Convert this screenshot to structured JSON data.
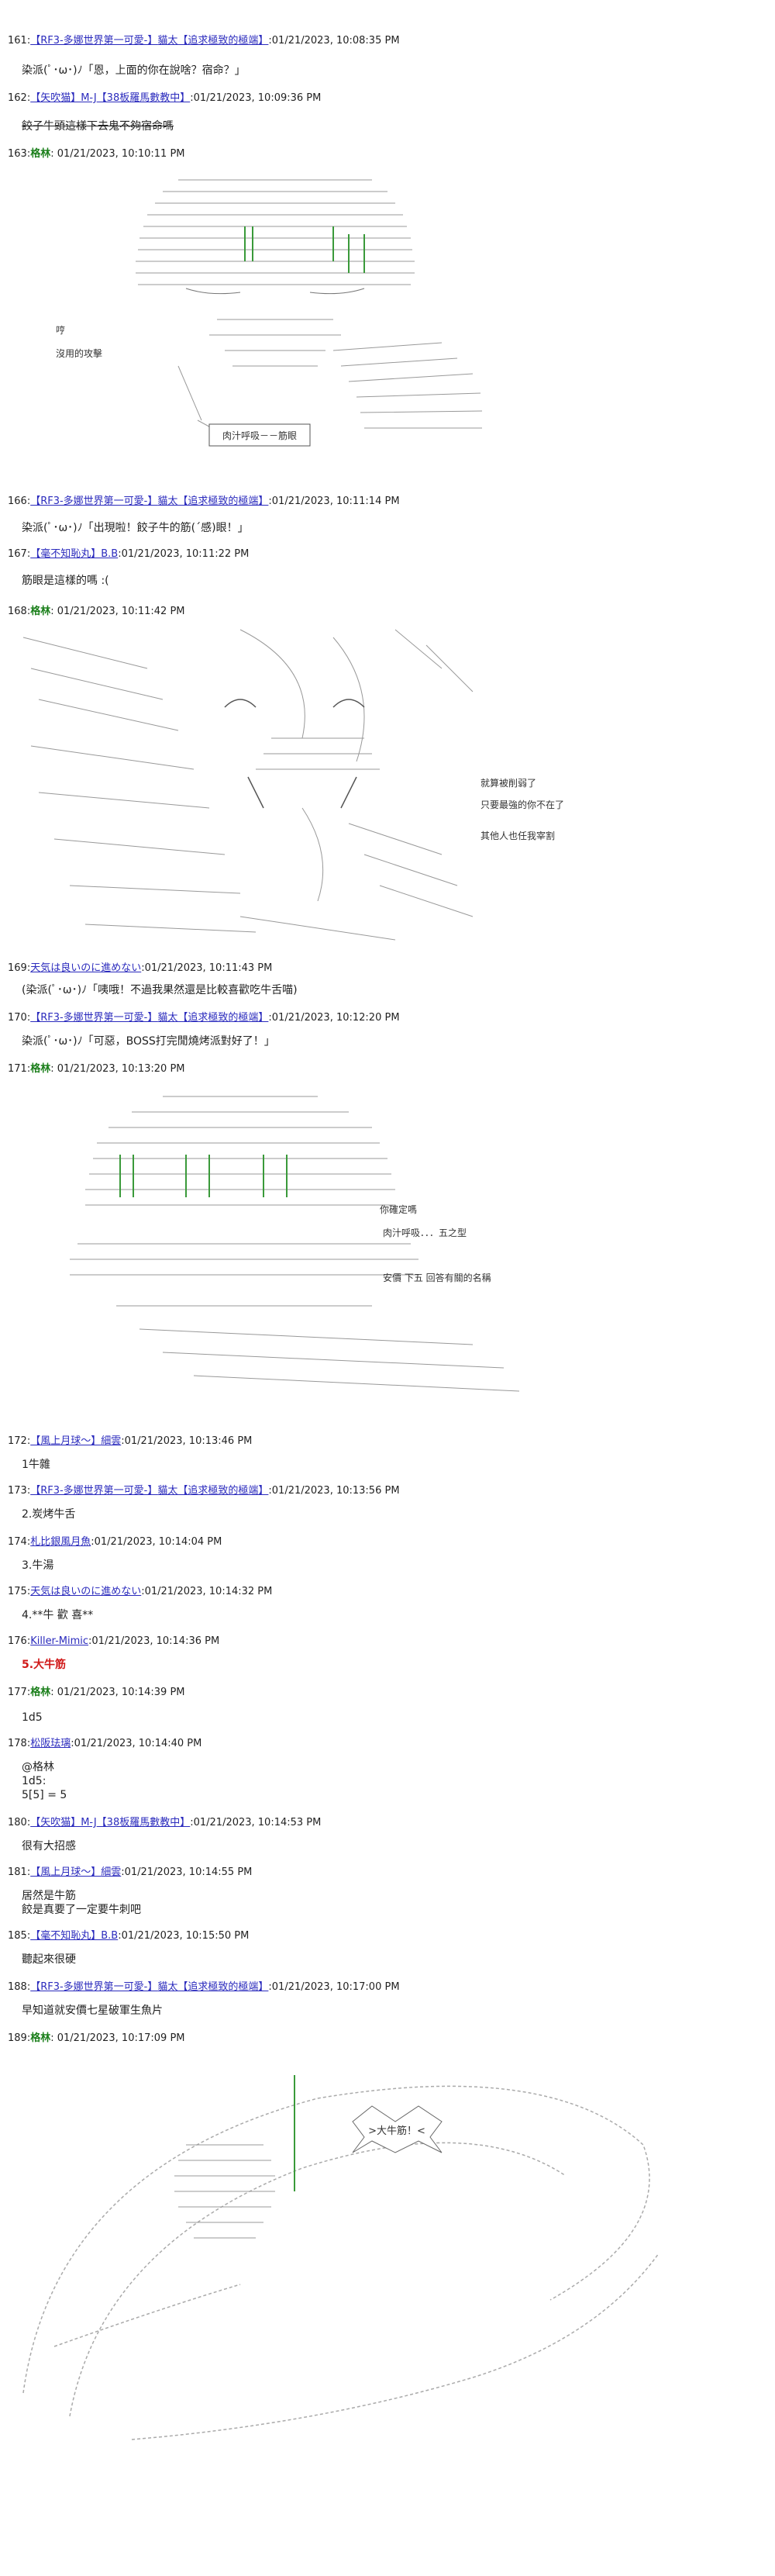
{
  "posts": [
    {
      "num": "161:",
      "user": "【RF3-多娜世界第一可愛-】",
      "tag": "貓太【追求極致的極端】",
      "date": ":01/21/2023, 10:08:35 PM",
      "body": "染派(ﾟ･ω･)ﾉ「恩，上面的你在說啥？宿命？」"
    },
    {
      "num": "162:",
      "user": "【矢吹猫】M-J",
      "tag": "【38板羅馬數教中】",
      "date": ":01/21/2023, 10:09:36 PM",
      "body": "餃子牛頭這樣下去鬼不夠宿命嗎"
    },
    {
      "num": "163:",
      "user": "格林",
      "date": ": 01/21/2023, 10:10:11 PM",
      "aa_text": [
        "哼",
        "沒用的攻擊"
      ],
      "bubble": "肉汁呼吸－－筋眼"
    },
    {
      "num": "166:",
      "user": "【RF3-多娜世界第一可愛-】",
      "tag": "貓太【追求極致的極端】",
      "date": ":01/21/2023, 10:11:14 PM",
      "body": "染派(ﾟ･ω･)ﾉ「出現啦！餃子牛的筋(ˊ感)眼！」"
    },
    {
      "num": "167:",
      "user": "【毫不知恥丸】B.B",
      "date": ":01/21/2023, 10:11:22 PM",
      "body": "筋眼是這樣的嗎 :("
    },
    {
      "num": "168:",
      "user": "格林",
      "date": ": 01/21/2023, 10:11:42 PM",
      "aa_text": [
        "就算被削弱了",
        "只要最強的你不在了",
        "其他人也任我宰割"
      ]
    },
    {
      "num": "169:",
      "user": "天気は良いのに進めない",
      "date": ":01/21/2023, 10:11:43 PM",
      "body": "(染派(ﾟ･ω･)ﾉ「咦哦！不過我果然還是比較喜歡吃牛舌喵)"
    },
    {
      "num": "170:",
      "user": "【RF3-多娜世界第一可愛-】",
      "tag": "貓太【追求極致的極端】",
      "date": ":01/21/2023, 10:12:20 PM",
      "body": "染派(ﾟ･ω･)ﾉ「可惡，BOSS打完閒燒烤派對好了！」"
    },
    {
      "num": "171:",
      "user": "格林",
      "date": ": 01/21/2023, 10:13:20 PM",
      "aa_text": [
        "你確定嗎",
        "肉汁呼吸．．．五之型",
        "安價 下五 回答有關的名稱"
      ]
    },
    {
      "num": "172:",
      "user": "【風上月球～】",
      "tag": "細雲",
      "date": ":01/21/2023, 10:13:46 PM",
      "body": "1牛雜"
    },
    {
      "num": "173:",
      "user": "【RF3-多娜世界第一可愛-】",
      "tag": "貓太【追求極致的極端】",
      "date": ":01/21/2023, 10:13:56 PM",
      "body": "2.炭烤牛舌"
    },
    {
      "num": "174:",
      "user": "札比銀風月魚",
      "date": ":01/21/2023, 10:14:04 PM",
      "body": "3.牛湯"
    },
    {
      "num": "175:",
      "user": "天気は良いのに進めない",
      "date": ":01/21/2023, 10:14:32 PM",
      "body": "4.**牛 歡 喜**"
    },
    {
      "num": "176:",
      "user": "Killer-Mimic",
      "date": ":01/21/2023, 10:14:36 PM",
      "body": "5.大牛筋"
    },
    {
      "num": "177:",
      "user": "格林",
      "date": ": 01/21/2023, 10:14:39 PM",
      "body": "1d5"
    },
    {
      "num": "178:",
      "user": "松阪珐璃",
      "date": ":01/21/2023, 10:14:40 PM",
      "body": "@格林\n1d5:\n5[5] = 5"
    },
    {
      "num": "180:",
      "user": "【矢吹猫】M-J",
      "tag": "【38板羅馬數教中】",
      "date": ":01/21/2023, 10:14:53 PM",
      "body": "很有大招感"
    },
    {
      "num": "181:",
      "user": "【風上月球～】",
      "tag": "細雲",
      "date": ":01/21/2023, 10:14:55 PM",
      "body": "居然是牛筋\n餃是真要了一定要牛刺吧"
    },
    {
      "num": "185:",
      "user": "【毫不知恥丸】B.B",
      "date": ":01/21/2023, 10:15:50 PM",
      "body": "聽起來很硬"
    },
    {
      "num": "188:",
      "user": "【RF3-多娜世界第一可愛-】",
      "tag": "貓太【追求極致的極端】",
      "date": ":01/21/2023, 10:17:00 PM",
      "body": "早知道就安價七星破軍生魚片"
    },
    {
      "num": "189:",
      "user": "格林",
      "date": ": 01/21/2023, 10:17:09 PM",
      "bubble": ">大牛筋！<"
    }
  ]
}
